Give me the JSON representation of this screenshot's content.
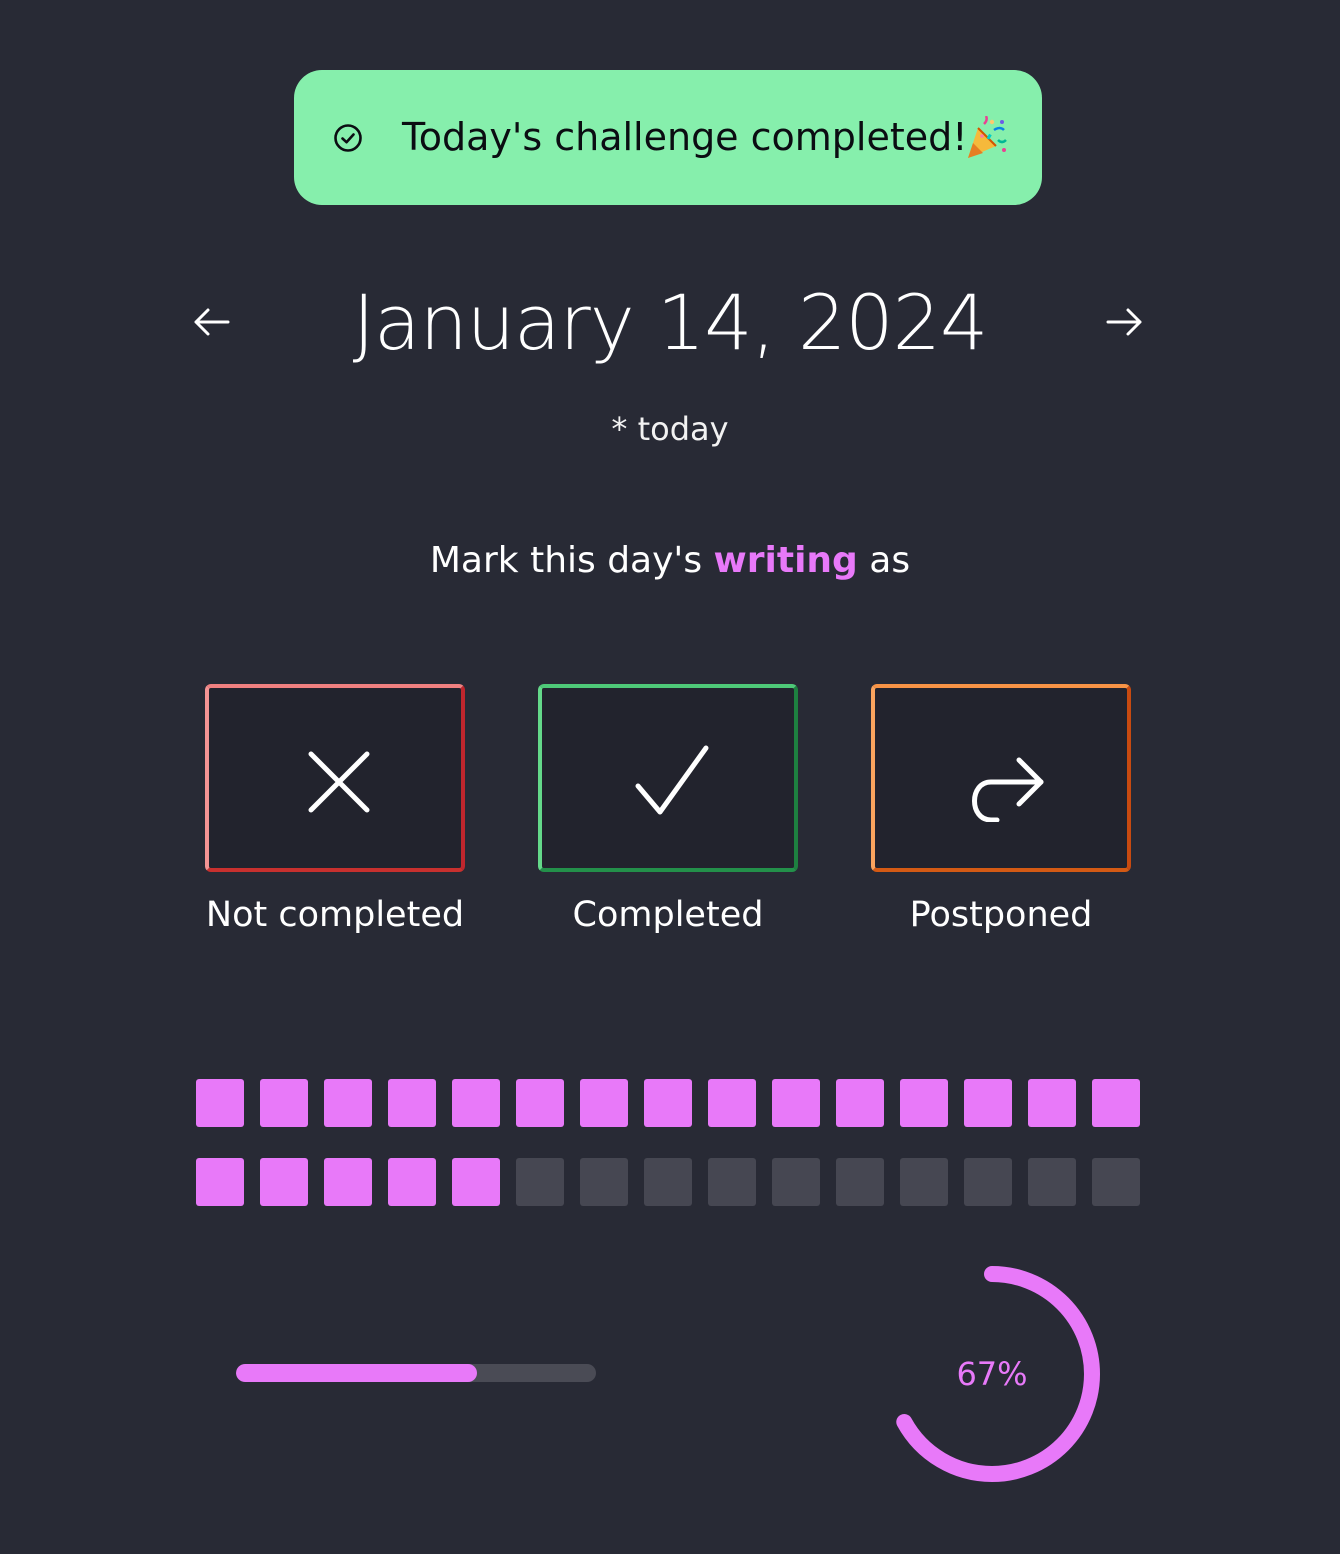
{
  "toast": {
    "icon": "check-circle-icon",
    "message": "Today's challenge completed!",
    "emoji_icon": "party-popper-icon",
    "background": "#86efac"
  },
  "date_nav": {
    "prev_icon": "arrow-left-icon",
    "next_icon": "arrow-right-icon",
    "date": "January 14, 2024",
    "note": "* today"
  },
  "prompt": {
    "before": "Mark this day's",
    "habit": "writing",
    "after": "as",
    "habit_color": "#e879f9"
  },
  "choices": [
    {
      "label": "Not completed",
      "icon": "x-icon",
      "color": "#e0504d"
    },
    {
      "label": "Completed",
      "icon": "check-icon",
      "color": "#2fab57"
    },
    {
      "label": "Postponed",
      "icon": "redo-arrow-icon",
      "color": "#ea7420"
    }
  ],
  "day_grid": {
    "total_days": 30,
    "completed_days": 20,
    "done_color": "#e879f9",
    "todo_color": "#464752"
  },
  "progress_bar": {
    "fraction": 0.67
  },
  "progress_ring": {
    "percent": 67,
    "label": "67%"
  },
  "colors": {
    "background": "#282a35",
    "accent": "#e879f9"
  }
}
